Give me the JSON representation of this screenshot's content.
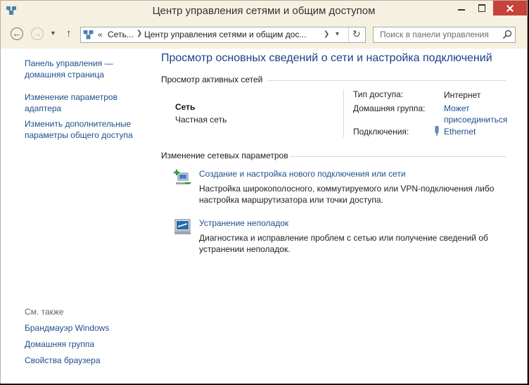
{
  "window": {
    "title": "Центр управления сетями и общим доступом"
  },
  "address": {
    "overflow": "«",
    "crumbs": [
      "Сеть...",
      "Центр управления сетями и общим дос..."
    ]
  },
  "search": {
    "placeholder": "Поиск в панели управления"
  },
  "sidebar": {
    "links": [
      "Панель управления — домашняя страница",
      "Изменение параметров адаптера",
      "Изменить дополнительные параметры общего доступа"
    ],
    "see_also_label": "См. также",
    "see_also": [
      "Брандмауэр Windows",
      "Домашняя группа",
      "Свойства браузера"
    ]
  },
  "main": {
    "title": "Просмотр основных сведений о сети и настройка подключений",
    "active_header": "Просмотр активных сетей",
    "network": {
      "name": "Сеть",
      "type": "Частная сеть",
      "access_label": "Тип доступа:",
      "access_value": "Интернет",
      "homegroup_label": "Домашняя группа:",
      "homegroup_value": "Может присоединиться",
      "connections_label": "Подключения:",
      "connections_value": "Ethernet"
    },
    "change_header": "Изменение сетевых параметров",
    "tasks": [
      {
        "title": "Создание и настройка нового подключения или сети",
        "desc": "Настройка широкополосного, коммутируемого или VPN-подключения либо настройка маршрутизатора или точки доступа.",
        "icon": "new-connection-icon"
      },
      {
        "title": "Устранение неполадок",
        "desc": "Диагностика и исправление проблем с сетью или получение сведений об устранении неполадок.",
        "icon": "troubleshoot-icon"
      }
    ]
  },
  "colors": {
    "link": "#1d4f8e",
    "title": "#1e3f86",
    "close_button": "#c7423a",
    "chrome": "#f5f0e0"
  }
}
